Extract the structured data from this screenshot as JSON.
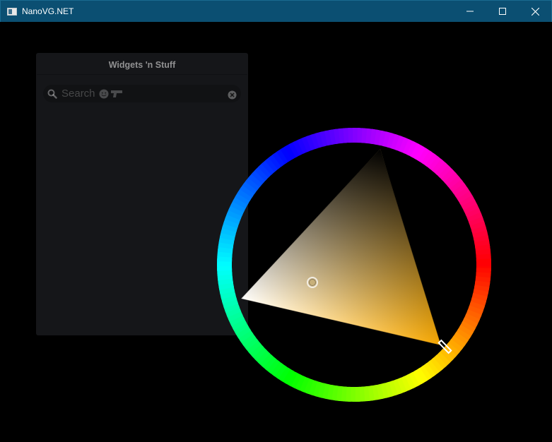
{
  "window": {
    "title": "NanoVG.NET",
    "controls": [
      "minimize-icon",
      "maximize-icon",
      "close-icon"
    ]
  },
  "panel": {
    "title": "Widgets 'n Stuff",
    "search": {
      "placeholder": "Search",
      "icons": [
        "search-icon",
        "smiley-icon",
        "gun-icon",
        "clear-icon"
      ]
    }
  },
  "color_picker": {
    "hue_degrees": 46,
    "selected_color": "#f2a818",
    "ring_hues": [
      "#ff0000",
      "#ffff00",
      "#00ff00",
      "#00ffff",
      "#0000ff",
      "#ff00ff"
    ]
  }
}
